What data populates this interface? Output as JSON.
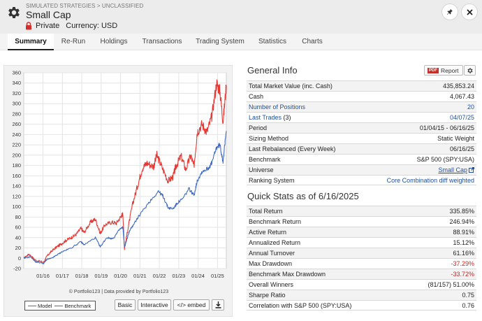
{
  "header": {
    "breadcrumb": "SIMULATED STRATEGIES > UNCLASSIFIED",
    "title": "Small Cap",
    "visibility": "Private",
    "currency": "Currency: USD"
  },
  "tabs": [
    {
      "label": "Summary",
      "active": true
    },
    {
      "label": "Re-Run"
    },
    {
      "label": "Holdings"
    },
    {
      "label": "Transactions"
    },
    {
      "label": "Trading System"
    },
    {
      "label": "Statistics"
    },
    {
      "label": "Charts"
    }
  ],
  "chart": {
    "copyright": "© Portfolio123 | Data provided by Portfolio123",
    "legend": {
      "model": "Model",
      "benchmark": "Benchmark"
    },
    "buttons": {
      "basic": "Basic",
      "interactive": "Interactive",
      "embed": "</> embed"
    }
  },
  "chart_data": {
    "type": "line",
    "ylabel": "",
    "ylim": [
      -20,
      360
    ],
    "y_ticks": [
      -20,
      0,
      20,
      40,
      60,
      80,
      100,
      120,
      140,
      160,
      180,
      200,
      220,
      240,
      260,
      280,
      300,
      320,
      340,
      360
    ],
    "x_ticks": [
      "01/16",
      "01/17",
      "01/18",
      "01/19",
      "01/20",
      "01/21",
      "01/22",
      "01/23",
      "01/24",
      "01/25"
    ],
    "x_range": [
      "2015-01-04",
      "2025-06-16"
    ],
    "grid": true,
    "series": [
      {
        "name": "Model",
        "color": "#e53935",
        "points": [
          [
            "2015-01-04",
            0
          ],
          [
            "2015-04",
            8
          ],
          [
            "2015-08",
            -4
          ],
          [
            "2016-01",
            -8
          ],
          [
            "2016-03",
            4
          ],
          [
            "2016-06",
            14
          ],
          [
            "2016-09",
            22
          ],
          [
            "2016-12",
            28
          ],
          [
            "2017-03",
            35
          ],
          [
            "2017-06",
            40
          ],
          [
            "2017-09",
            46
          ],
          [
            "2017-12",
            58
          ],
          [
            "2018-02",
            50
          ],
          [
            "2018-06",
            70
          ],
          [
            "2018-09",
            76
          ],
          [
            "2018-12",
            48
          ],
          [
            "2019-03",
            65
          ],
          [
            "2019-07",
            70
          ],
          [
            "2019-10",
            68
          ],
          [
            "2020-01",
            82
          ],
          [
            "2020-02",
            86
          ],
          [
            "2020-03",
            18
          ],
          [
            "2020-05",
            55
          ],
          [
            "2020-08",
            105
          ],
          [
            "2020-11",
            140
          ],
          [
            "2021-02",
            175
          ],
          [
            "2021-05",
            185
          ],
          [
            "2021-09",
            178
          ],
          [
            "2021-11",
            200
          ],
          [
            "2022-02",
            178
          ],
          [
            "2022-06",
            150
          ],
          [
            "2022-09",
            158
          ],
          [
            "2022-11",
            180
          ],
          [
            "2023-02",
            198
          ],
          [
            "2023-05",
            172
          ],
          [
            "2023-08",
            200
          ],
          [
            "2023-10",
            178
          ],
          [
            "2023-12",
            245
          ],
          [
            "2024-03",
            260
          ],
          [
            "2024-06",
            245
          ],
          [
            "2024-09",
            275
          ],
          [
            "2024-12",
            340
          ],
          [
            "2025-02",
            325
          ],
          [
            "2025-04",
            265
          ],
          [
            "2025-06-16",
            336
          ]
        ]
      },
      {
        "name": "Benchmark",
        "color": "#3f6bc4",
        "points": [
          [
            "2015-01-04",
            0
          ],
          [
            "2015-05",
            3
          ],
          [
            "2015-08",
            -7
          ],
          [
            "2016-01",
            -10
          ],
          [
            "2016-03",
            -2
          ],
          [
            "2016-06",
            0
          ],
          [
            "2016-09",
            6
          ],
          [
            "2016-12",
            12
          ],
          [
            "2017-06",
            20
          ],
          [
            "2017-12",
            32
          ],
          [
            "2018-02",
            26
          ],
          [
            "2018-09",
            40
          ],
          [
            "2018-12",
            22
          ],
          [
            "2019-04",
            40
          ],
          [
            "2019-08",
            38
          ],
          [
            "2019-12",
            56
          ],
          [
            "2020-02",
            60
          ],
          [
            "2020-03",
            22
          ],
          [
            "2020-06",
            52
          ],
          [
            "2020-09",
            68
          ],
          [
            "2020-12",
            82
          ],
          [
            "2021-06",
            108
          ],
          [
            "2021-12",
            130
          ],
          [
            "2022-03",
            120
          ],
          [
            "2022-06",
            98
          ],
          [
            "2022-09",
            96
          ],
          [
            "2022-12",
            108
          ],
          [
            "2023-03",
            115
          ],
          [
            "2023-07",
            135
          ],
          [
            "2023-10",
            122
          ],
          [
            "2023-12",
            150
          ],
          [
            "2024-03",
            168
          ],
          [
            "2024-07",
            175
          ],
          [
            "2024-09",
            185
          ],
          [
            "2024-12",
            215
          ],
          [
            "2025-02",
            220
          ],
          [
            "2025-04",
            188
          ],
          [
            "2025-06-16",
            247
          ]
        ]
      }
    ]
  },
  "general_info": {
    "title": "General Info",
    "report_label": "Report",
    "pdf_label": "PDF",
    "rows": [
      {
        "label": "Total Market Value (inc. Cash)",
        "value": "435,853.24"
      },
      {
        "label": "Cash",
        "value": "4,067.43"
      },
      {
        "label": "Number of Positions",
        "value": "20"
      },
      {
        "label": "Last Trades",
        "count": "(3)",
        "value": "04/07/25"
      },
      {
        "label": "Period",
        "value": "01/04/15 - 06/16/25"
      },
      {
        "label": "Sizing Method",
        "value": "Static Weight"
      },
      {
        "label": "Last Rebalanced (Every Week)",
        "value": "06/16/25"
      },
      {
        "label": "Benchmark",
        "value": "S&P 500 (SPY:USA)"
      },
      {
        "label": "Universe",
        "value": "Small Cap"
      },
      {
        "label": "Ranking System",
        "value": "Core Combination diff weighted"
      }
    ]
  },
  "quick_stats": {
    "title": "Quick Stats as of 6/16/2025",
    "rows": [
      {
        "label": "Total Return",
        "value": "335.85%"
      },
      {
        "label": "Benchmark Return",
        "value": "246.94%"
      },
      {
        "label": "Active Return",
        "value": "88.91%"
      },
      {
        "label": "Annualized Return",
        "value": "15.12%"
      },
      {
        "label": "Annual Turnover",
        "value": "61.16%"
      },
      {
        "label": "Max Drawdown",
        "value": "-37.29%"
      },
      {
        "label": "Benchmark Max Drawdown",
        "value": "-33.72%"
      },
      {
        "label": "Overall Winners",
        "value": "(81/157) 51.00%"
      },
      {
        "label": "Sharpe Ratio",
        "value": "0.75"
      },
      {
        "label": "Correlation with S&P 500 (SPY:USA)",
        "value": "0.76"
      }
    ]
  },
  "colors": {
    "model": "#e53935",
    "benchmark": "#3f6bc4",
    "link": "#1f4f9e",
    "negative": "#c62828"
  },
  "icons": [
    "gear-icon",
    "lock-icon",
    "pin-icon",
    "close-icon",
    "external-link-icon",
    "download-icon"
  ]
}
